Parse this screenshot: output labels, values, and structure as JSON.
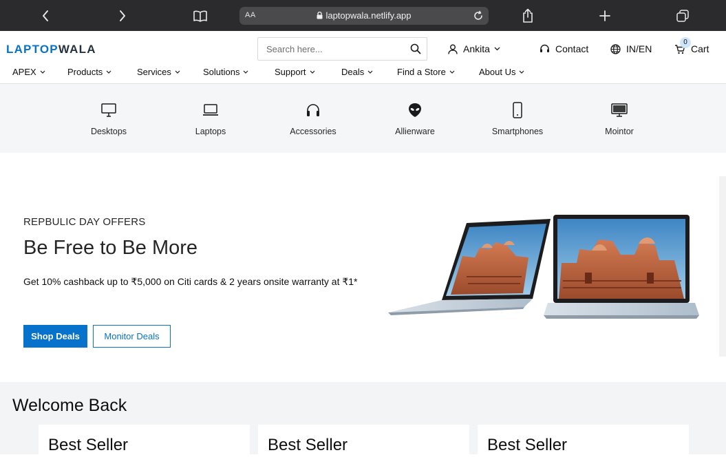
{
  "browser": {
    "aa_label": "AA",
    "url": "laptopwala.netlify.app"
  },
  "header": {
    "logo_part1": "LAPTOP",
    "logo_part2": "WALA",
    "search_placeholder": "Search here...",
    "user_label": "Ankita",
    "contact_label": "Contact",
    "locale_label": "IN/EN",
    "cart_label": "Cart",
    "cart_count": "0"
  },
  "nav": {
    "items": [
      {
        "label": "APEX"
      },
      {
        "label": "Products"
      },
      {
        "label": "Services"
      },
      {
        "label": "Solutions"
      },
      {
        "label": "Support"
      },
      {
        "label": "Deals"
      },
      {
        "label": "Find a Store"
      },
      {
        "label": "About Us"
      }
    ]
  },
  "categories": [
    {
      "label": "Desktops",
      "icon": "desktop-icon"
    },
    {
      "label": "Laptops",
      "icon": "laptop-icon"
    },
    {
      "label": "Accessories",
      "icon": "headphones-icon"
    },
    {
      "label": "Allienware",
      "icon": "alien-icon"
    },
    {
      "label": "Smartphones",
      "icon": "smartphone-icon"
    },
    {
      "label": "Mointor",
      "icon": "monitor-icon"
    }
  ],
  "hero": {
    "eyebrow": "REPBULIC DAY OFFERS",
    "title": "Be Free to Be More",
    "text": "Get 10% cashback up to ₹5,000 on Citi cards & 2 years onsite warranty at ₹1*",
    "primary_button": "Shop Deals",
    "secondary_button": "Monitor Deals"
  },
  "welcome": {
    "title": "Welcome Back",
    "cards": [
      {
        "label": "Best Seller"
      },
      {
        "label": "Best Seller"
      },
      {
        "label": "Best Seller"
      }
    ]
  },
  "colors": {
    "accent": "#0672cb",
    "browser_bar": "#2b2b2d",
    "category_bg": "#f5f6f7"
  }
}
